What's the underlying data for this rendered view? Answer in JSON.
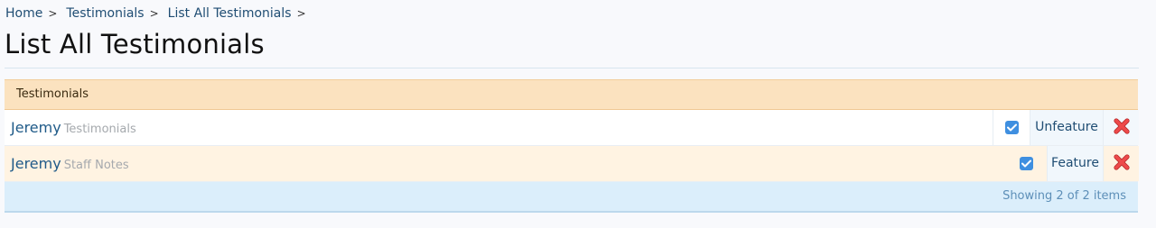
{
  "breadcrumb": {
    "items": [
      "Home",
      "Testimonials",
      "List All Testimonials"
    ],
    "separator": ">"
  },
  "page": {
    "title": "List All Testimonials"
  },
  "panel": {
    "header": "Testimonials"
  },
  "rows": [
    {
      "name": "Jeremy",
      "type": "Testimonials",
      "checked": true,
      "action": "Unfeature"
    },
    {
      "name": "Jeremy",
      "type": "Staff Notes",
      "checked": true,
      "action": "Feature"
    }
  ],
  "footer": {
    "text": "Showing 2 of 2 items"
  },
  "icons": {
    "checkbox": "checkmark-icon",
    "delete": "delete-x-icon"
  },
  "colors": {
    "link": "#1f4d73",
    "header_bg": "#fbe2bf",
    "footer_bg": "#dbeefb",
    "checkbox": "#3f8fe0",
    "delete": "#e23f3f"
  }
}
